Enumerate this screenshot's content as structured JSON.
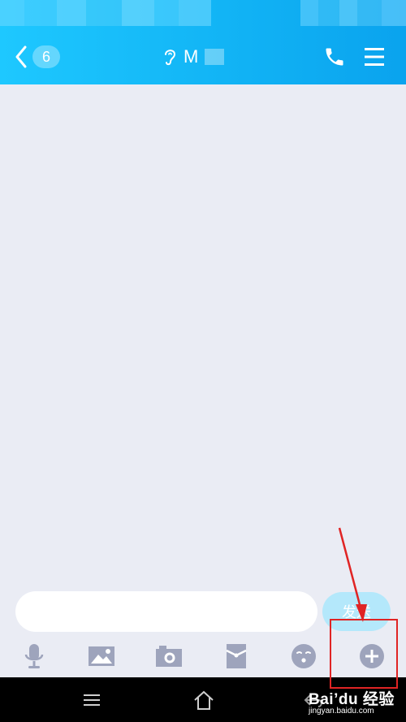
{
  "header": {
    "back_badge_count": "6",
    "chat_title": "M"
  },
  "input_bar": {
    "message_value": "",
    "message_placeholder": "",
    "send_label": "发送"
  },
  "toolbar": {
    "items": [
      "microphone-icon",
      "image-icon",
      "camera-icon",
      "red-packet-icon",
      "emoji-icon",
      "plus-icon"
    ]
  },
  "watermark": {
    "brand": "Bai’du 经验",
    "url": "jingyan.baidu.com"
  },
  "colors": {
    "header_start": "#1ec8ff",
    "header_end": "#0aa3ee",
    "background": "#eaecf4",
    "icon": "#9ea4bc",
    "send_button": "#b4e8fb",
    "annotation": "#e02424"
  }
}
